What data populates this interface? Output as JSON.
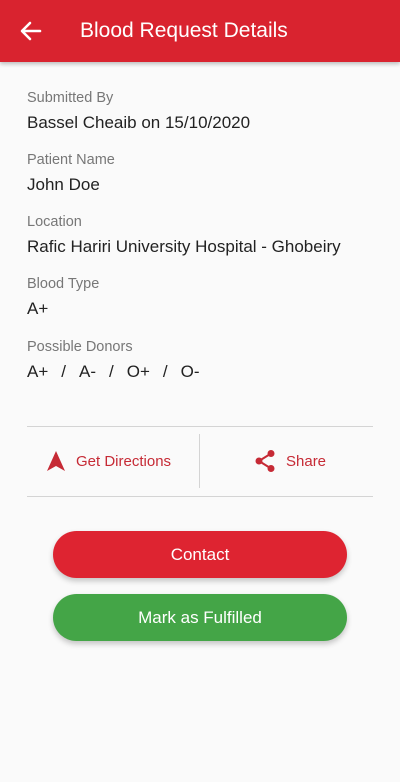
{
  "header": {
    "title": "Blood Request Details",
    "back_icon": "arrow-left-icon"
  },
  "details": {
    "submitted_by_label": "Submitted By",
    "submitted_by_value": "Bassel Cheaib on 15/10/2020",
    "patient_label": "Patient Name",
    "patient_value": "John Doe",
    "location_label": "Location",
    "location_value": "Rafic Hariri University Hospital - Ghobeiry",
    "blood_type_label": "Blood Type",
    "blood_type_value": "A+",
    "donors_label": "Possible Donors",
    "donors": [
      "A+",
      "A-",
      "O+",
      "O-"
    ],
    "donor_separator": "/"
  },
  "actions": {
    "directions_label": "Get Directions",
    "directions_icon": "navigation-icon",
    "share_label": "Share",
    "share_icon": "share-icon"
  },
  "buttons": {
    "contact_label": "Contact",
    "fulfill_label": "Mark as Fulfilled"
  },
  "colors": {
    "primary_red": "#d9232f",
    "contact_red": "#de2431",
    "fulfilled_green": "#44a547",
    "action_red": "#c62a35"
  }
}
